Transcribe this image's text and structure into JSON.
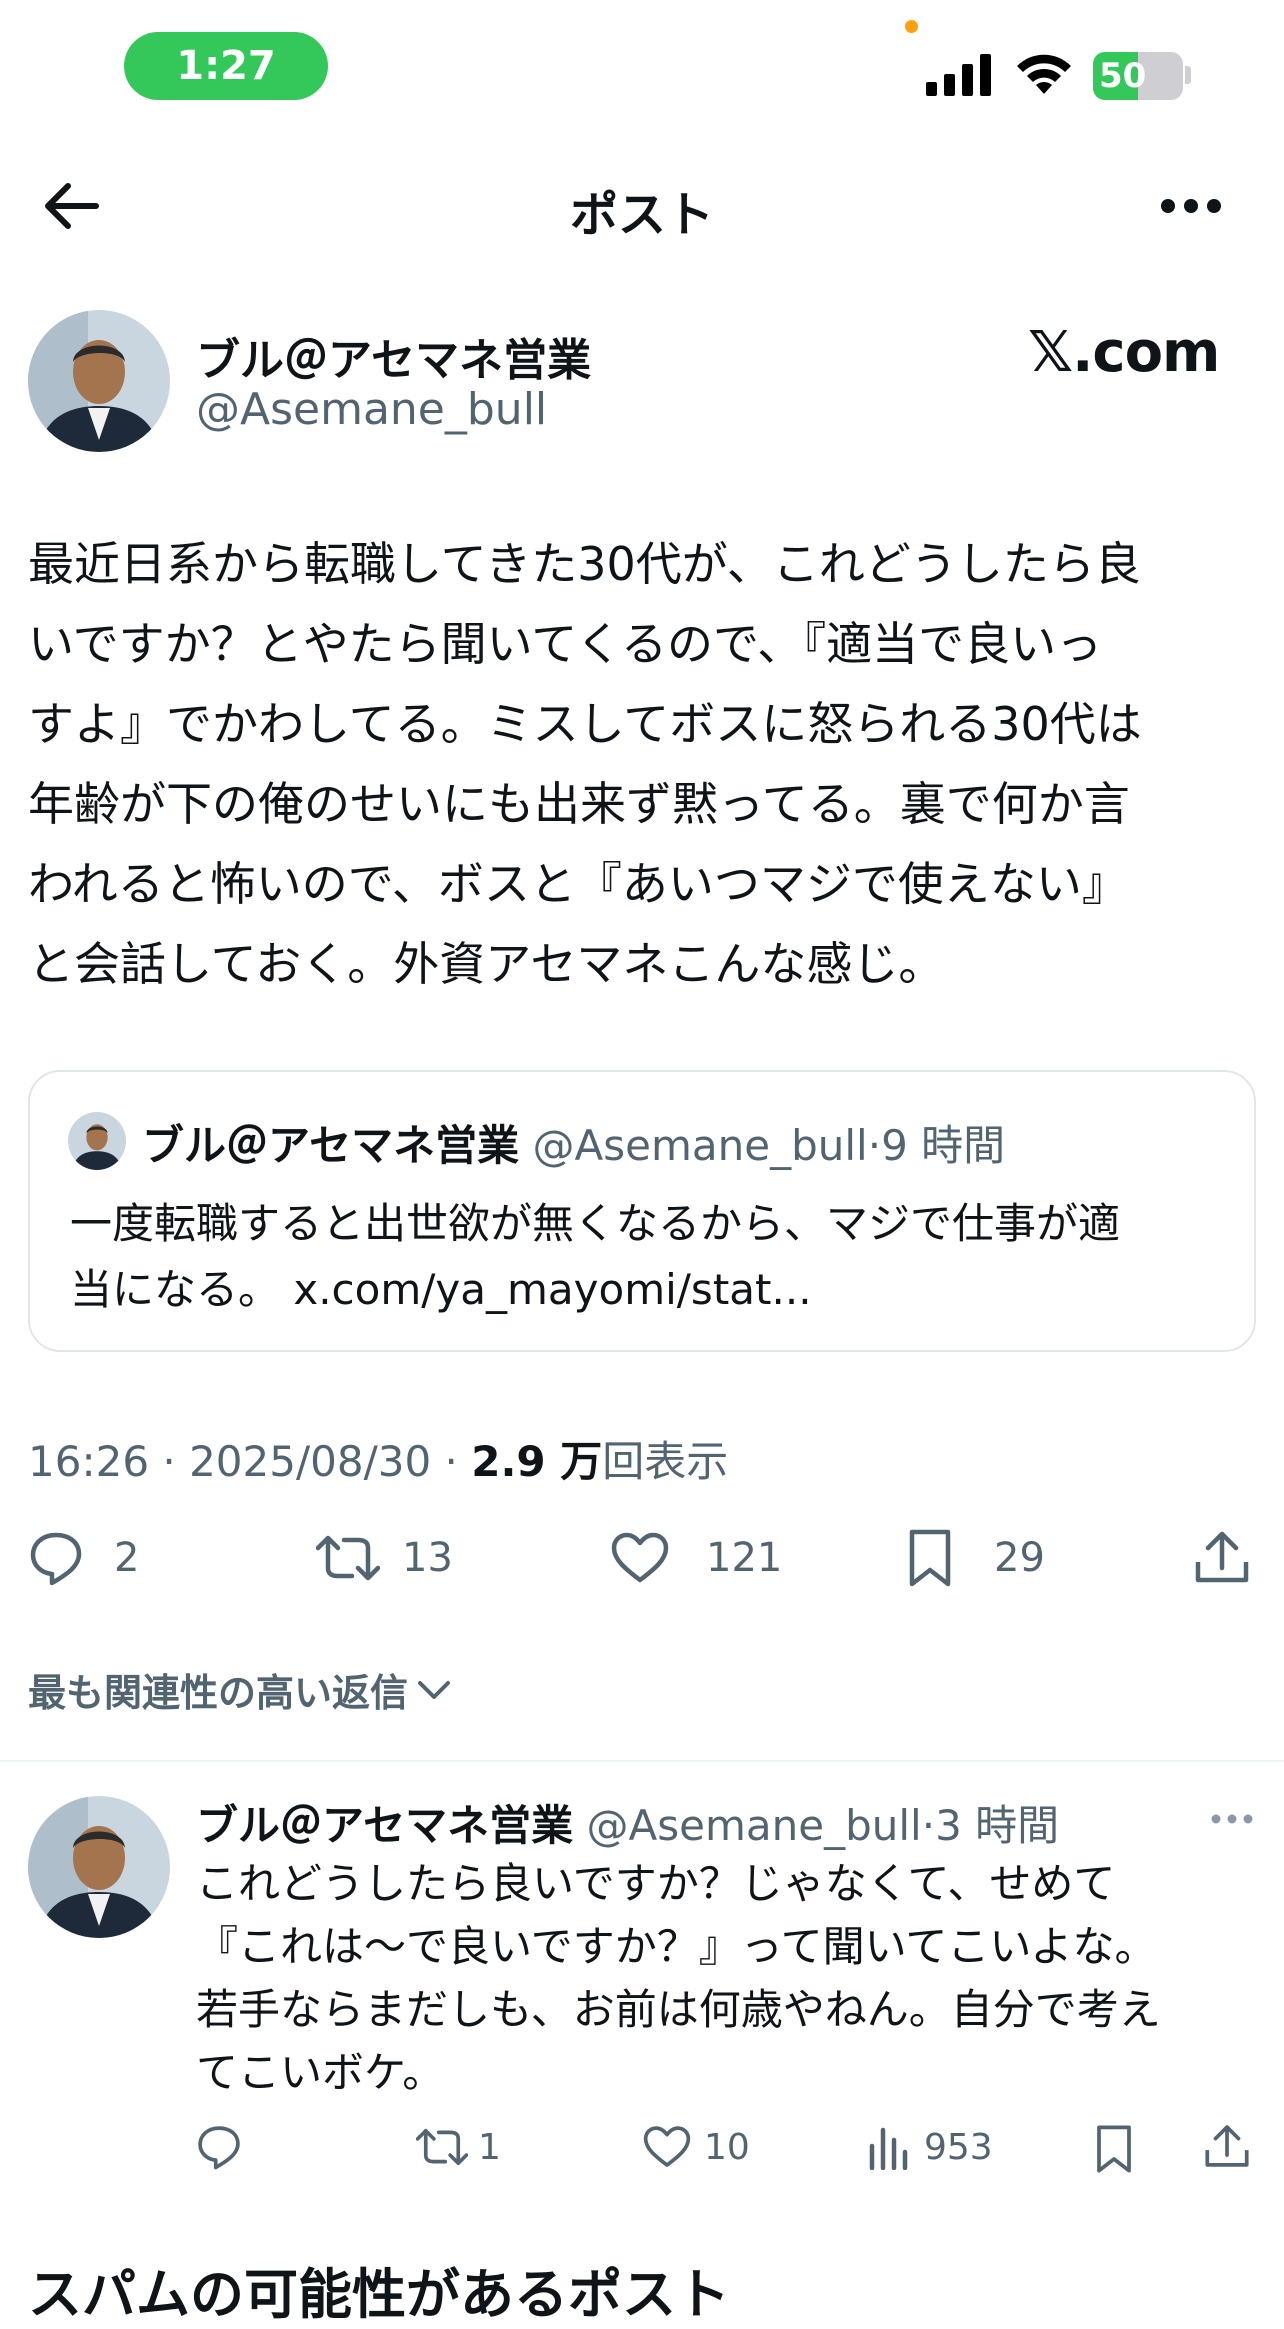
{
  "status_bar": {
    "time": "1:27",
    "battery": "50",
    "battery_level": 0.5
  },
  "header": {
    "title": "ポスト"
  },
  "post": {
    "author_name": "ブル＠アセマネ営業",
    "author_handle": "@Asemane_bull",
    "brand": "𝕏.com",
    "text_lines": [
      "最近日系から転職してきた30代が、これどうしたら良",
      "いですか？とやたら聞いてくるので、『適当で良いっ",
      "すよ』でかわしてる。ミスしてボスに怒られる30代は",
      "年齢が下の俺のせいにも出来ず黙ってる。裏で何か言",
      "われると怖いので、ボスと『あいつマジで使えない』",
      "と会話しておく。外資アセマネこんな感じ。"
    ],
    "quote": {
      "author_name": "ブル＠アセマネ営業",
      "author_handle": "@Asemane_bull",
      "time": "9 時間",
      "text_line1": "一度転職すると出世欲が無くなるから、マジで仕事が適",
      "text_line2": "当になる。 x.com/ya_mayomi/stat..."
    },
    "meta": {
      "timestamp": "16:26 · 2025/08/30 · ",
      "views_count": "2.9 万",
      "views_label": "回表示"
    },
    "actions": {
      "replies": "2",
      "reposts": "13",
      "likes": "121",
      "bookmarks": "29"
    }
  },
  "replies_section": {
    "sort_label": "最も関連性の高い返信",
    "reply": {
      "author_name": "ブル＠アセマネ営業",
      "author_handle": "@Asemane_bull",
      "time": "3 時間",
      "text_lines": [
        "これどうしたら良いですか？じゃなくて、せめて",
        "『これは〜で良いですか？』って聞いてこいよな。",
        "若手ならまだしも、お前は何歳やねん。自分で考え",
        "てこいボケ。"
      ],
      "actions": {
        "replies": "",
        "reposts": "1",
        "likes": "10",
        "views": "953"
      }
    }
  },
  "spam_heading": "スパムの可能性があるポスト",
  "colors": {
    "accent_green": "#34c759",
    "secondary_text": "#536471",
    "border": "#e1e6ea"
  }
}
